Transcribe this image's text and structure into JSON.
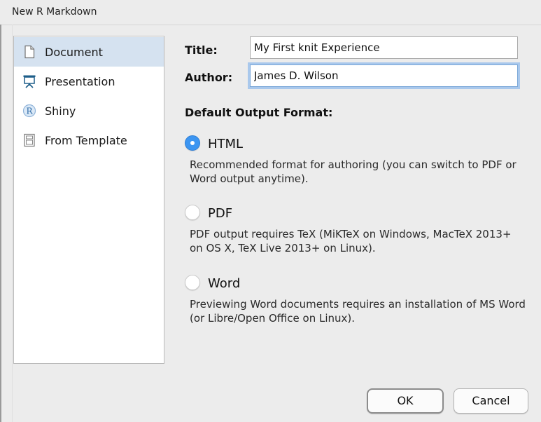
{
  "window": {
    "title": "New R Markdown"
  },
  "sidebar": {
    "items": [
      {
        "label": "Document",
        "icon": "document-icon",
        "selected": true
      },
      {
        "label": "Presentation",
        "icon": "presentation-icon",
        "selected": false
      },
      {
        "label": "Shiny",
        "icon": "shiny-r-icon",
        "selected": false
      },
      {
        "label": "From Template",
        "icon": "template-icon",
        "selected": false
      }
    ]
  },
  "form": {
    "title_label": "Title:",
    "title_value": "My First knit Experience",
    "author_label": "Author:",
    "author_value": "James D. Wilson",
    "output_heading": "Default Output Format:",
    "formats": [
      {
        "label": "HTML",
        "checked": true,
        "description": "Recommended format for authoring (you can switch to PDF or Word output anytime)."
      },
      {
        "label": "PDF",
        "checked": false,
        "description": "PDF output requires TeX (MiKTeX on Windows, MacTeX 2013+ on OS X, TeX Live 2013+ on Linux)."
      },
      {
        "label": "Word",
        "checked": false,
        "description": "Previewing Word documents requires an installation of MS Word (or Libre/Open Office on Linux)."
      }
    ]
  },
  "buttons": {
    "ok": "OK",
    "cancel": "Cancel"
  },
  "colors": {
    "selection": "#d5e2f0",
    "radio_checked": "#3c95f1",
    "focus_ring": "#a9c8ec"
  }
}
